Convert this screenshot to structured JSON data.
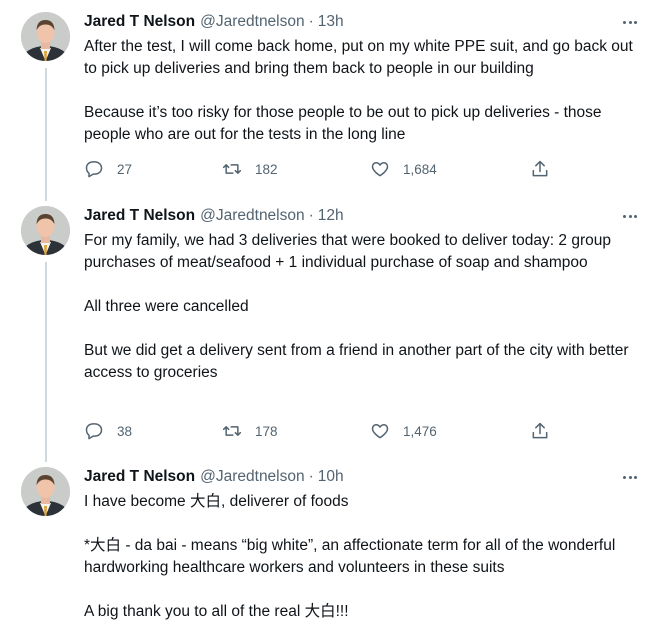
{
  "tweets": [
    {
      "author": {
        "name": "Jared T Nelson",
        "handle": "@Jaredtnelson"
      },
      "separator": "·",
      "time": "13h",
      "paragraphs": [
        "After the test, I will come back home, put on my white PPE suit, and go back out to pick up deliveries and bring them back to people in our building",
        "Because it’s too risky for those people to be out to pick up deliveries - those people who are out for the tests in the long line"
      ],
      "stats": {
        "replies": "27",
        "retweets": "182",
        "likes": "1,684"
      }
    },
    {
      "author": {
        "name": "Jared T Nelson",
        "handle": "@Jaredtnelson"
      },
      "separator": "·",
      "time": "12h",
      "paragraphs": [
        "For my family, we had 3 deliveries that were booked to deliver today: 2 group purchases of meat/seafood + 1 individual purchase of soap and shampoo",
        "All three were cancelled",
        "But we did get a delivery sent from a friend in another part of the city with better access to groceries"
      ],
      "stats": {
        "replies": "38",
        "retweets": "178",
        "likes": "1,476"
      }
    },
    {
      "author": {
        "name": "Jared T Nelson",
        "handle": "@Jaredtnelson"
      },
      "separator": "·",
      "time": "10h",
      "paragraphs": [
        "I have become 大白, deliverer of foods",
        "*大白 - da bai - means “big white”, an affectionate term for all of the wonderful hardworking healthcare workers and volunteers in these suits",
        "A big thank you to all of the real 大白!!!"
      ]
    }
  ],
  "icons": {
    "reply": "reply-icon",
    "retweet": "retweet-icon",
    "like": "heart-icon",
    "share": "share-icon",
    "more": "more-icon"
  },
  "colors": {
    "text": "#0f1419",
    "secondary": "#536471",
    "thread_line": "#cfd9de"
  }
}
